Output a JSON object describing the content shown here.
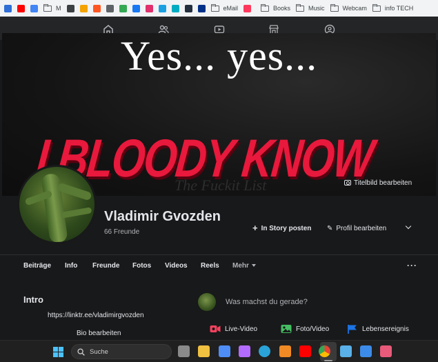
{
  "bookmarks": [
    {
      "icon": "mail-app-icon",
      "color": "#2f6fd6",
      "label": ""
    },
    {
      "icon": "youtube-icon",
      "color": "#ff0000",
      "label": ""
    },
    {
      "icon": "google-icon",
      "color": "#4285f4",
      "label": ""
    },
    {
      "icon": "folder-icon",
      "color": "#5f6368",
      "label": "M"
    },
    {
      "icon": "news-icon",
      "color": "#3c4043",
      "label": ""
    },
    {
      "icon": "pdf-icon",
      "color": "#f4a300",
      "label": ""
    },
    {
      "icon": "blogger-icon",
      "color": "#ff5722",
      "label": ""
    },
    {
      "icon": "globe-icon",
      "color": "#5f6368",
      "label": ""
    },
    {
      "icon": "star-burst-icon",
      "color": "#34a853",
      "label": ""
    },
    {
      "icon": "facebook-icon",
      "color": "#1877f2",
      "label": ""
    },
    {
      "icon": "instagram-icon",
      "color": "#e1306c",
      "label": ""
    },
    {
      "icon": "tool-icon",
      "color": "#1ba1e2",
      "label": ""
    },
    {
      "icon": "tumblr-icon",
      "color": "#00acc1",
      "label": ""
    },
    {
      "icon": "amazon-icon",
      "color": "#232f3e",
      "label": ""
    },
    {
      "icon": "paypal-icon",
      "color": "#003087",
      "label": ""
    },
    {
      "icon": "folder-icon",
      "color": "#5f6368",
      "label": "eMail"
    },
    {
      "icon": "airbnb-icon",
      "color": "#ff385c",
      "label": ""
    },
    {
      "icon": "folder-icon",
      "color": "#5f6368",
      "label": "Books"
    },
    {
      "icon": "folder-icon",
      "color": "#5f6368",
      "label": "Music"
    },
    {
      "icon": "folder-icon",
      "color": "#5f6368",
      "label": "Webcam"
    },
    {
      "icon": "folder-icon",
      "color": "#5f6368",
      "label": "info TECH"
    }
  ],
  "cover": {
    "line1": "Yes... yes...",
    "line2": "I BLOODY KNOW",
    "watermark": "The Fuckit List",
    "edit_cover_label": "Titelbild bearbeiten"
  },
  "profile": {
    "name": "Vladimir Gvozden",
    "friends": "66 Freunde",
    "story_button": "In Story posten",
    "edit_button": "Profil bearbeiten"
  },
  "tabs": [
    "Beiträge",
    "Info",
    "Freunde",
    "Fotos",
    "Videos",
    "Reels",
    "Mehr"
  ],
  "intro": {
    "title": "Intro",
    "link": "https://linktr.ee/vladimirgvozden",
    "bio_button": "Bio bearbeiten"
  },
  "composer": {
    "prompt": "Was machst du gerade?",
    "actions": [
      {
        "label": "Live-Video",
        "icon": "live-video-icon",
        "color": "#f3425f"
      },
      {
        "label": "Foto/Video",
        "icon": "photo-video-icon",
        "color": "#45bd62"
      },
      {
        "label": "Lebensereignis",
        "icon": "life-event-flag-icon",
        "color": "#1b74e4"
      }
    ]
  },
  "taskbar": {
    "search_label": "Suche",
    "apps": [
      {
        "icon": "task-view-icon",
        "color": "#8a8a8a"
      },
      {
        "icon": "file-explorer-icon",
        "color": "#f0c040"
      },
      {
        "icon": "store-icon",
        "color": "#4f8ef7"
      },
      {
        "icon": "copilot-icon",
        "color": "#b36bff"
      },
      {
        "icon": "edge-icon",
        "color": "#2aa3d8"
      },
      {
        "icon": "media-player-icon",
        "color": "#f08a24"
      },
      {
        "icon": "youtube-icon",
        "color": "#ff0000"
      },
      {
        "icon": "chrome-icon",
        "color": "#fbbc04"
      },
      {
        "icon": "notepad-icon",
        "color": "#5ab0e8"
      },
      {
        "icon": "photos-icon",
        "color": "#3d8be8"
      },
      {
        "icon": "snipping-tool-icon",
        "color": "#e85a7a"
      }
    ]
  }
}
